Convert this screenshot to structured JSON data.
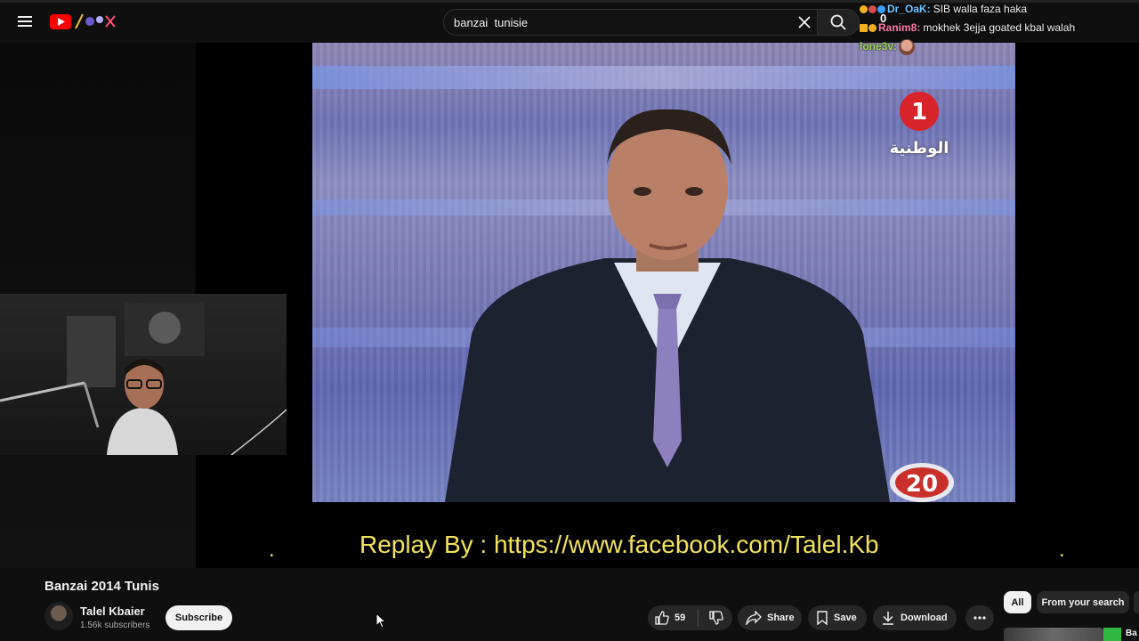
{
  "search": {
    "query": "banzai  tunisie"
  },
  "chat": [
    {
      "user": "Dr_OaK:",
      "message": "SIB walla faza haka",
      "user_color": "#6ec3ff",
      "badges": [
        "#f2b01e",
        "#d94b4b",
        "#3aa0ff"
      ]
    },
    {
      "user": "Ranim8:",
      "message": "mokhek 3ejja goated kbal walah",
      "user_color": "#ff77a8",
      "badges": [
        "#f2b01e",
        "#f2b01e"
      ]
    },
    {
      "user": "lone3v:",
      "message": "",
      "user_color": "#9bd64f",
      "badges": []
    }
  ],
  "chat_counter": "0",
  "video": {
    "overlay_text": "Replay By : https://www.facebook.com/Talel.Kb",
    "channel_logo_text": "الوطنية",
    "corner_badge": "20"
  },
  "title": "Banzai 2014 Tunis",
  "channel": {
    "name": "Talel Kbaier",
    "subscribers": "1.56k subscribers"
  },
  "subscribe_label": "Subscribe",
  "actions": {
    "likes": "59",
    "share": "Share",
    "save": "Save",
    "download": "Download"
  },
  "chips": {
    "all": "All",
    "from_search": "From your search"
  },
  "next_video": {
    "title_fragment": "Ba"
  },
  "colors": {
    "accent": "#ff0000",
    "overlay_yellow": "#f2e35a",
    "background": "#0f0f0f"
  }
}
